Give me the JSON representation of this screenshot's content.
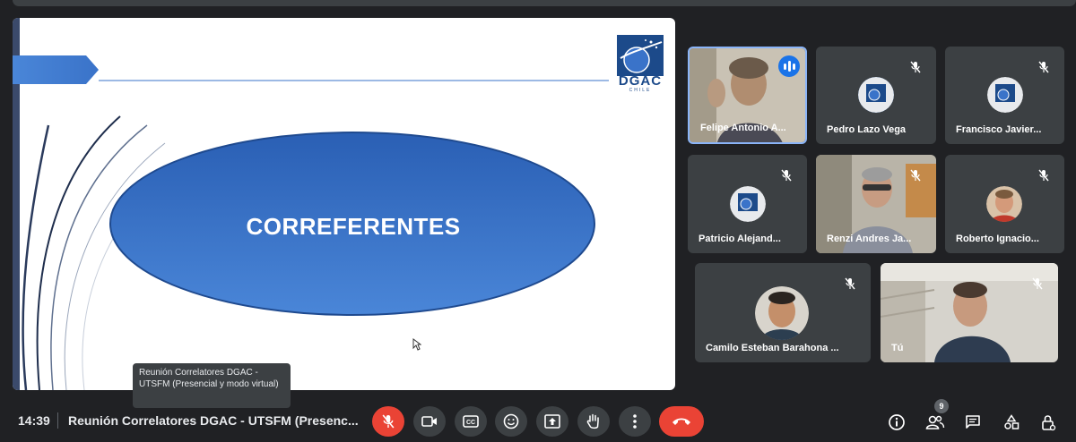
{
  "presentation": {
    "slide_title": "CORREFERENTES",
    "logo_text": "DGAC",
    "logo_subtext": "CHILE"
  },
  "tooltip": {
    "text": "Reunión Correlatores DGAC - UTSFM (Presencial y modo virtual)"
  },
  "participants": [
    {
      "name": "Felipe Antonio A...",
      "speaking": true
    },
    {
      "name": "Pedro Lazo Vega",
      "muted": true
    },
    {
      "name": "Francisco Javier...",
      "muted": true
    },
    {
      "name": "Patricio Alejand...",
      "muted": true
    },
    {
      "name": "Renzi Andres Ja...",
      "muted": true
    },
    {
      "name": "Roberto Ignacio...",
      "muted": true
    },
    {
      "name": "Camilo Esteban Barahona ...",
      "muted": true
    },
    {
      "name": "Tú",
      "muted": true
    }
  ],
  "bottom_bar": {
    "time": "14:39",
    "meeting_title": "Reunión Correlatores DGAC - UTSFM (Presenc...",
    "participant_count": "9",
    "icons": {
      "mic": "mic-off-icon",
      "camera": "camera-icon",
      "captions": "captions-icon",
      "reactions": "emoji-icon",
      "present": "present-icon",
      "hand": "raise-hand-icon",
      "more": "more-vert-icon",
      "leave": "leave-call-icon",
      "info": "info-icon",
      "people": "people-icon",
      "chat": "chat-icon",
      "activities": "activities-icon",
      "host": "host-controls-icon"
    }
  },
  "colors": {
    "background": "#202124",
    "tile": "#3c4043",
    "accent": "#8ab4f8",
    "danger": "#ea4335",
    "slide_blue": "#3a73c9"
  }
}
